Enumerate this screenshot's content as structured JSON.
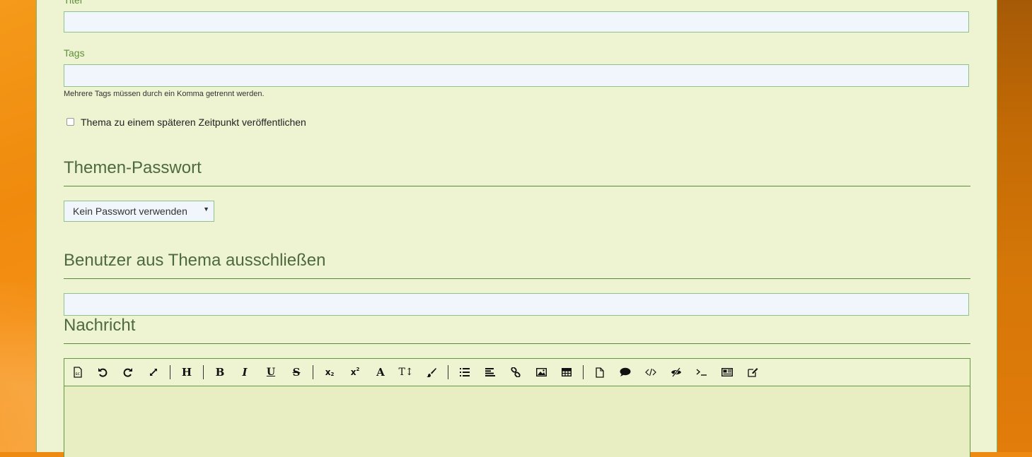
{
  "form": {
    "title_label": "Titel",
    "title_value": "",
    "tags_label": "Tags",
    "tags_value": "",
    "tags_help": "Mehrere Tags müssen durch ein Komma getrennt werden.",
    "schedule_label": "Thema zu einem späteren Zeitpunkt veröffentlichen",
    "schedule_checked": false
  },
  "password_section": {
    "heading": "Themen-Passwort",
    "selected": "Kein Passwort verwenden"
  },
  "exclude_section": {
    "heading": "Benutzer aus Thema ausschließen",
    "value": ""
  },
  "message_section": {
    "heading": "Nachricht"
  },
  "toolbar": {
    "buttons": [
      {
        "name": "source-icon",
        "glyph": "source"
      },
      {
        "name": "undo-icon",
        "glyph": "undo"
      },
      {
        "name": "redo-icon",
        "glyph": "redo"
      },
      {
        "name": "fullscreen-icon",
        "glyph": "expand"
      },
      {
        "name": "heading-icon",
        "glyph": "H"
      },
      {
        "name": "bold-icon",
        "glyph": "B"
      },
      {
        "name": "italic-icon",
        "glyph": "I"
      },
      {
        "name": "underline-icon",
        "glyph": "U"
      },
      {
        "name": "strikethrough-icon",
        "glyph": "S"
      },
      {
        "name": "subscript-icon",
        "glyph": "sub"
      },
      {
        "name": "superscript-icon",
        "glyph": "sup"
      },
      {
        "name": "font-icon",
        "glyph": "A"
      },
      {
        "name": "font-size-icon",
        "glyph": "TI"
      },
      {
        "name": "color-brush-icon",
        "glyph": "brush"
      },
      {
        "name": "list-icon",
        "glyph": "list"
      },
      {
        "name": "align-icon",
        "glyph": "align"
      },
      {
        "name": "link-icon",
        "glyph": "link"
      },
      {
        "name": "image-icon",
        "glyph": "image"
      },
      {
        "name": "table-icon",
        "glyph": "table"
      },
      {
        "name": "page-icon",
        "glyph": "page"
      },
      {
        "name": "quote-icon",
        "glyph": "quote"
      },
      {
        "name": "code-icon",
        "glyph": "code"
      },
      {
        "name": "spoiler-icon",
        "glyph": "spoiler"
      },
      {
        "name": "terminal-icon",
        "glyph": "terminal"
      },
      {
        "name": "media-icon",
        "glyph": "media"
      },
      {
        "name": "edit-icon",
        "glyph": "edit"
      }
    ]
  }
}
